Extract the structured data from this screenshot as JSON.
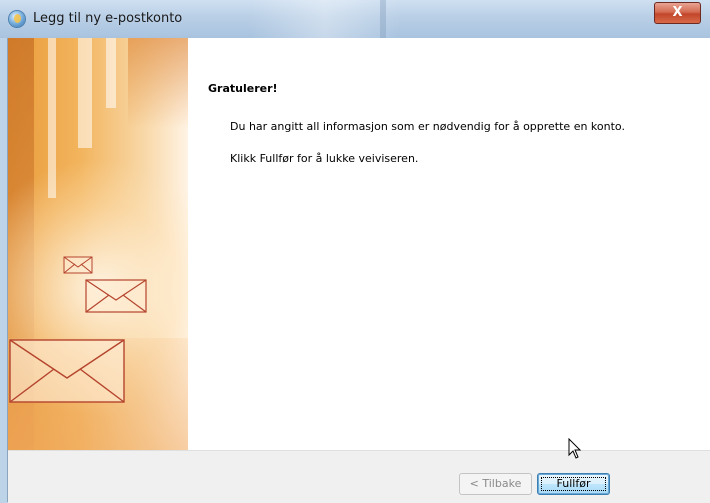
{
  "window": {
    "title": "Legg til ny e-postkonto",
    "close_label": "X"
  },
  "content": {
    "heading": "Gratulerer!",
    "line1": "Du har angitt all informasjon som er nødvendig for å opprette en konto.",
    "line2": "Klikk Fullfør for å lukke veiviseren."
  },
  "footer": {
    "back_label": "< Tilbake",
    "finish_label": "Fullfør"
  },
  "icons": {
    "app": "outlook-account-icon",
    "close": "close-icon",
    "cursor": "mouse-pointer-icon"
  },
  "colors": {
    "banner_accent": "#e99b3a",
    "envelope_stroke": "#b5442d",
    "primary_button": "#bee6fd"
  }
}
